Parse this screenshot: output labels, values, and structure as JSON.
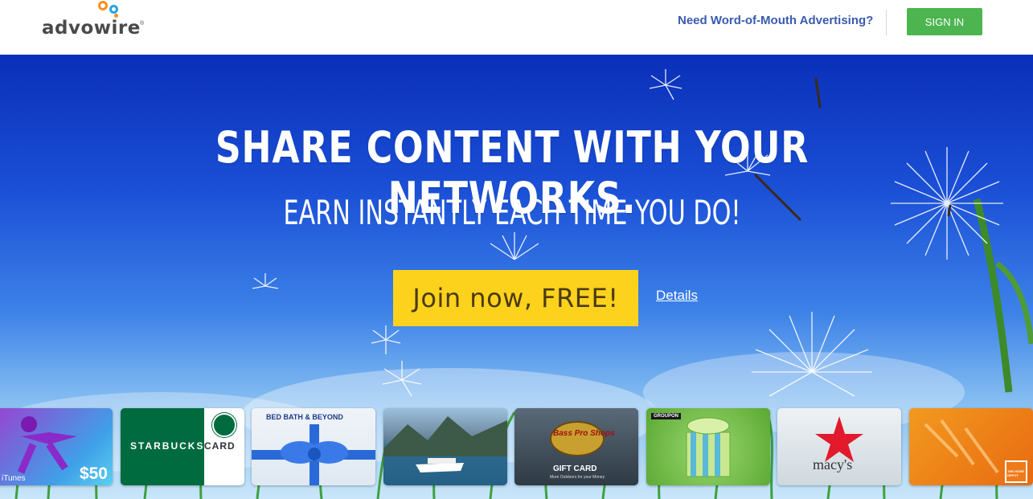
{
  "header": {
    "logo_text": "advowire",
    "logo_registered": "®",
    "advertising_link": "Need Word-of-Mouth Advertising?",
    "sign_in_label": "SIGN IN"
  },
  "hero": {
    "title": "SHARE CONTENT WITH YOUR NETWORKS.",
    "subtitle": "EARN INSTANTLY EACH TIME YOU DO!",
    "join_label": "Join now, FREE!",
    "details_label": "Details"
  },
  "gift_cards": [
    {
      "name": "itunes",
      "label": "iTunes",
      "amount": "$50"
    },
    {
      "name": "starbucks",
      "label": "STARBUCKS",
      "label2": "CARD"
    },
    {
      "name": "bed-bath-beyond",
      "label": "BED BATH & BEYOND"
    },
    {
      "name": "cruise",
      "label": ""
    },
    {
      "name": "bass-pro-shops",
      "label": "Bass Pro Shops",
      "label2": "GIFT CARD",
      "label3": "More Outdoors for your Money"
    },
    {
      "name": "groupon",
      "label": "GROUPON"
    },
    {
      "name": "macys",
      "label": "macy's"
    },
    {
      "name": "home-depot",
      "label": "THE HOME DEPOT"
    }
  ],
  "colors": {
    "brand_green": "#4cb550",
    "join_yellow": "#fcd21c",
    "link_blue": "#3a5bb0",
    "logo_orange": "#f5901e",
    "logo_blue": "#2aa3e0"
  }
}
